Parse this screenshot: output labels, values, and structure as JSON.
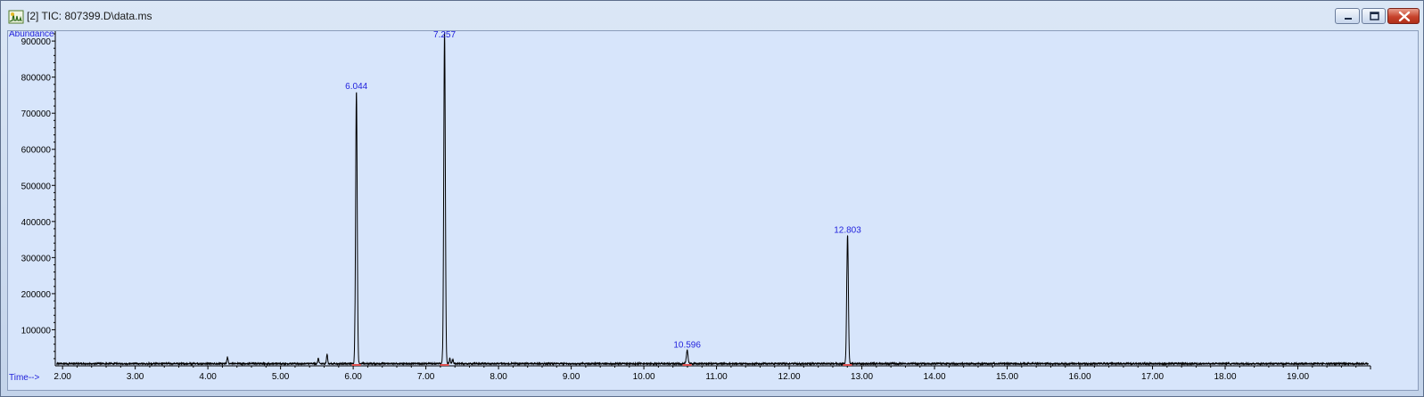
{
  "window": {
    "title": "[2] TIC: 807399.D\\data.ms",
    "icon": "chromatogram-app-icon",
    "buttons": [
      "minimize",
      "maximize",
      "close"
    ]
  },
  "colors": {
    "plot_background": "#d7e5fb",
    "trace": "#000000",
    "axis_label": "#1f1fd9",
    "peak_label": "#2222dd",
    "baseline_marker": "#e05050"
  },
  "chart_data": {
    "type": "line",
    "title": "",
    "xlabel": "Time-->",
    "ylabel": "Abundance",
    "xlim": [
      1.9,
      20.0
    ],
    "ylim": [
      0,
      920000
    ],
    "xticks": [
      "2.00",
      "3.00",
      "4.00",
      "5.00",
      "6.00",
      "7.00",
      "8.00",
      "9.00",
      "10.00",
      "11.00",
      "12.00",
      "13.00",
      "14.00",
      "15.00",
      "16.00",
      "17.00",
      "18.00",
      "19.00"
    ],
    "yticks": [
      "100000",
      "200000",
      "300000",
      "400000",
      "500000",
      "600000",
      "700000",
      "800000",
      "900000"
    ],
    "grid": false,
    "baseline": 6000,
    "peaks": [
      {
        "label": "6.044",
        "time": 6.044,
        "abundance": 755000
      },
      {
        "label": "7.257",
        "time": 7.257,
        "abundance": 920000
      },
      {
        "label": "10.596",
        "time": 10.596,
        "abundance": 38000
      },
      {
        "label": "12.803",
        "time": 12.803,
        "abundance": 357000
      }
    ],
    "minor_peaks": [
      {
        "time": 4.27,
        "abundance": 18000
      },
      {
        "time": 5.52,
        "abundance": 14000
      },
      {
        "time": 5.64,
        "abundance": 26000
      },
      {
        "time": 7.33,
        "abundance": 14000
      },
      {
        "time": 7.37,
        "abundance": 11000
      }
    ]
  }
}
